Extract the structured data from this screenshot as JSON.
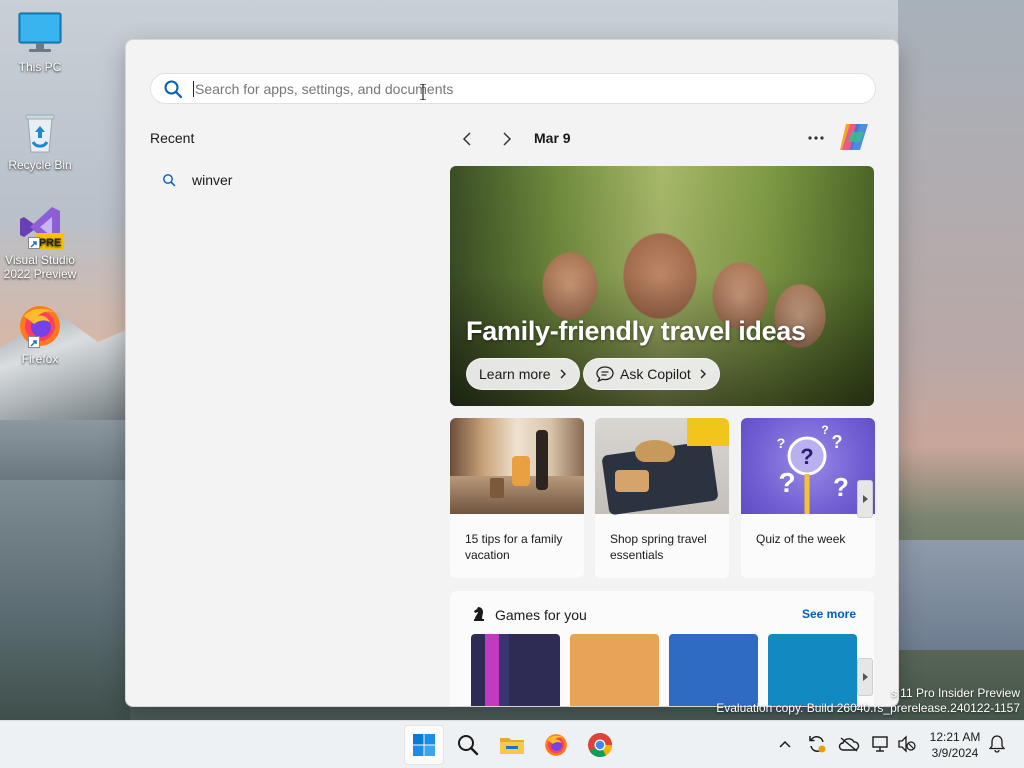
{
  "desktop": {
    "icons": [
      {
        "label": "This PC"
      },
      {
        "label": "Recycle Bin"
      },
      {
        "label": "Visual Studio 2022 Preview",
        "badge": "PRE"
      },
      {
        "label": "Firefox"
      }
    ]
  },
  "search": {
    "placeholder": "Search for apps, settings, and documents",
    "value": ""
  },
  "recent": {
    "title": "Recent",
    "items": [
      {
        "label": "winver",
        "icon": "search-icon"
      }
    ]
  },
  "feed": {
    "date": "Mar 9",
    "hero": {
      "title": "Family-friendly travel ideas",
      "learn_more": "Learn more",
      "ask_copilot": "Ask Copilot"
    },
    "cards": [
      {
        "text": "15 tips for a family vacation"
      },
      {
        "text": "Shop spring travel essentials"
      },
      {
        "text": "Quiz of the week"
      }
    ],
    "games": {
      "title": "Games for you",
      "see_more": "See more",
      "tile_colors": [
        "#2e2c55",
        "#e8a356",
        "#2f6bc2",
        "#1289c0"
      ]
    }
  },
  "watermark": {
    "line1": "s 11 Pro Insider Preview",
    "line2": "Evaluation copy. Build 26040.rs_prerelease.240122-1157"
  },
  "taskbar": {
    "apps": [
      "start",
      "search",
      "file-explorer",
      "firefox",
      "chrome"
    ],
    "clock": {
      "time": "12:21 AM",
      "date": "3/9/2024"
    }
  },
  "colors": {
    "accent": "#005fb8",
    "panel_bg": "#f3f3f3",
    "taskbar_bg": "#eef1f4"
  }
}
